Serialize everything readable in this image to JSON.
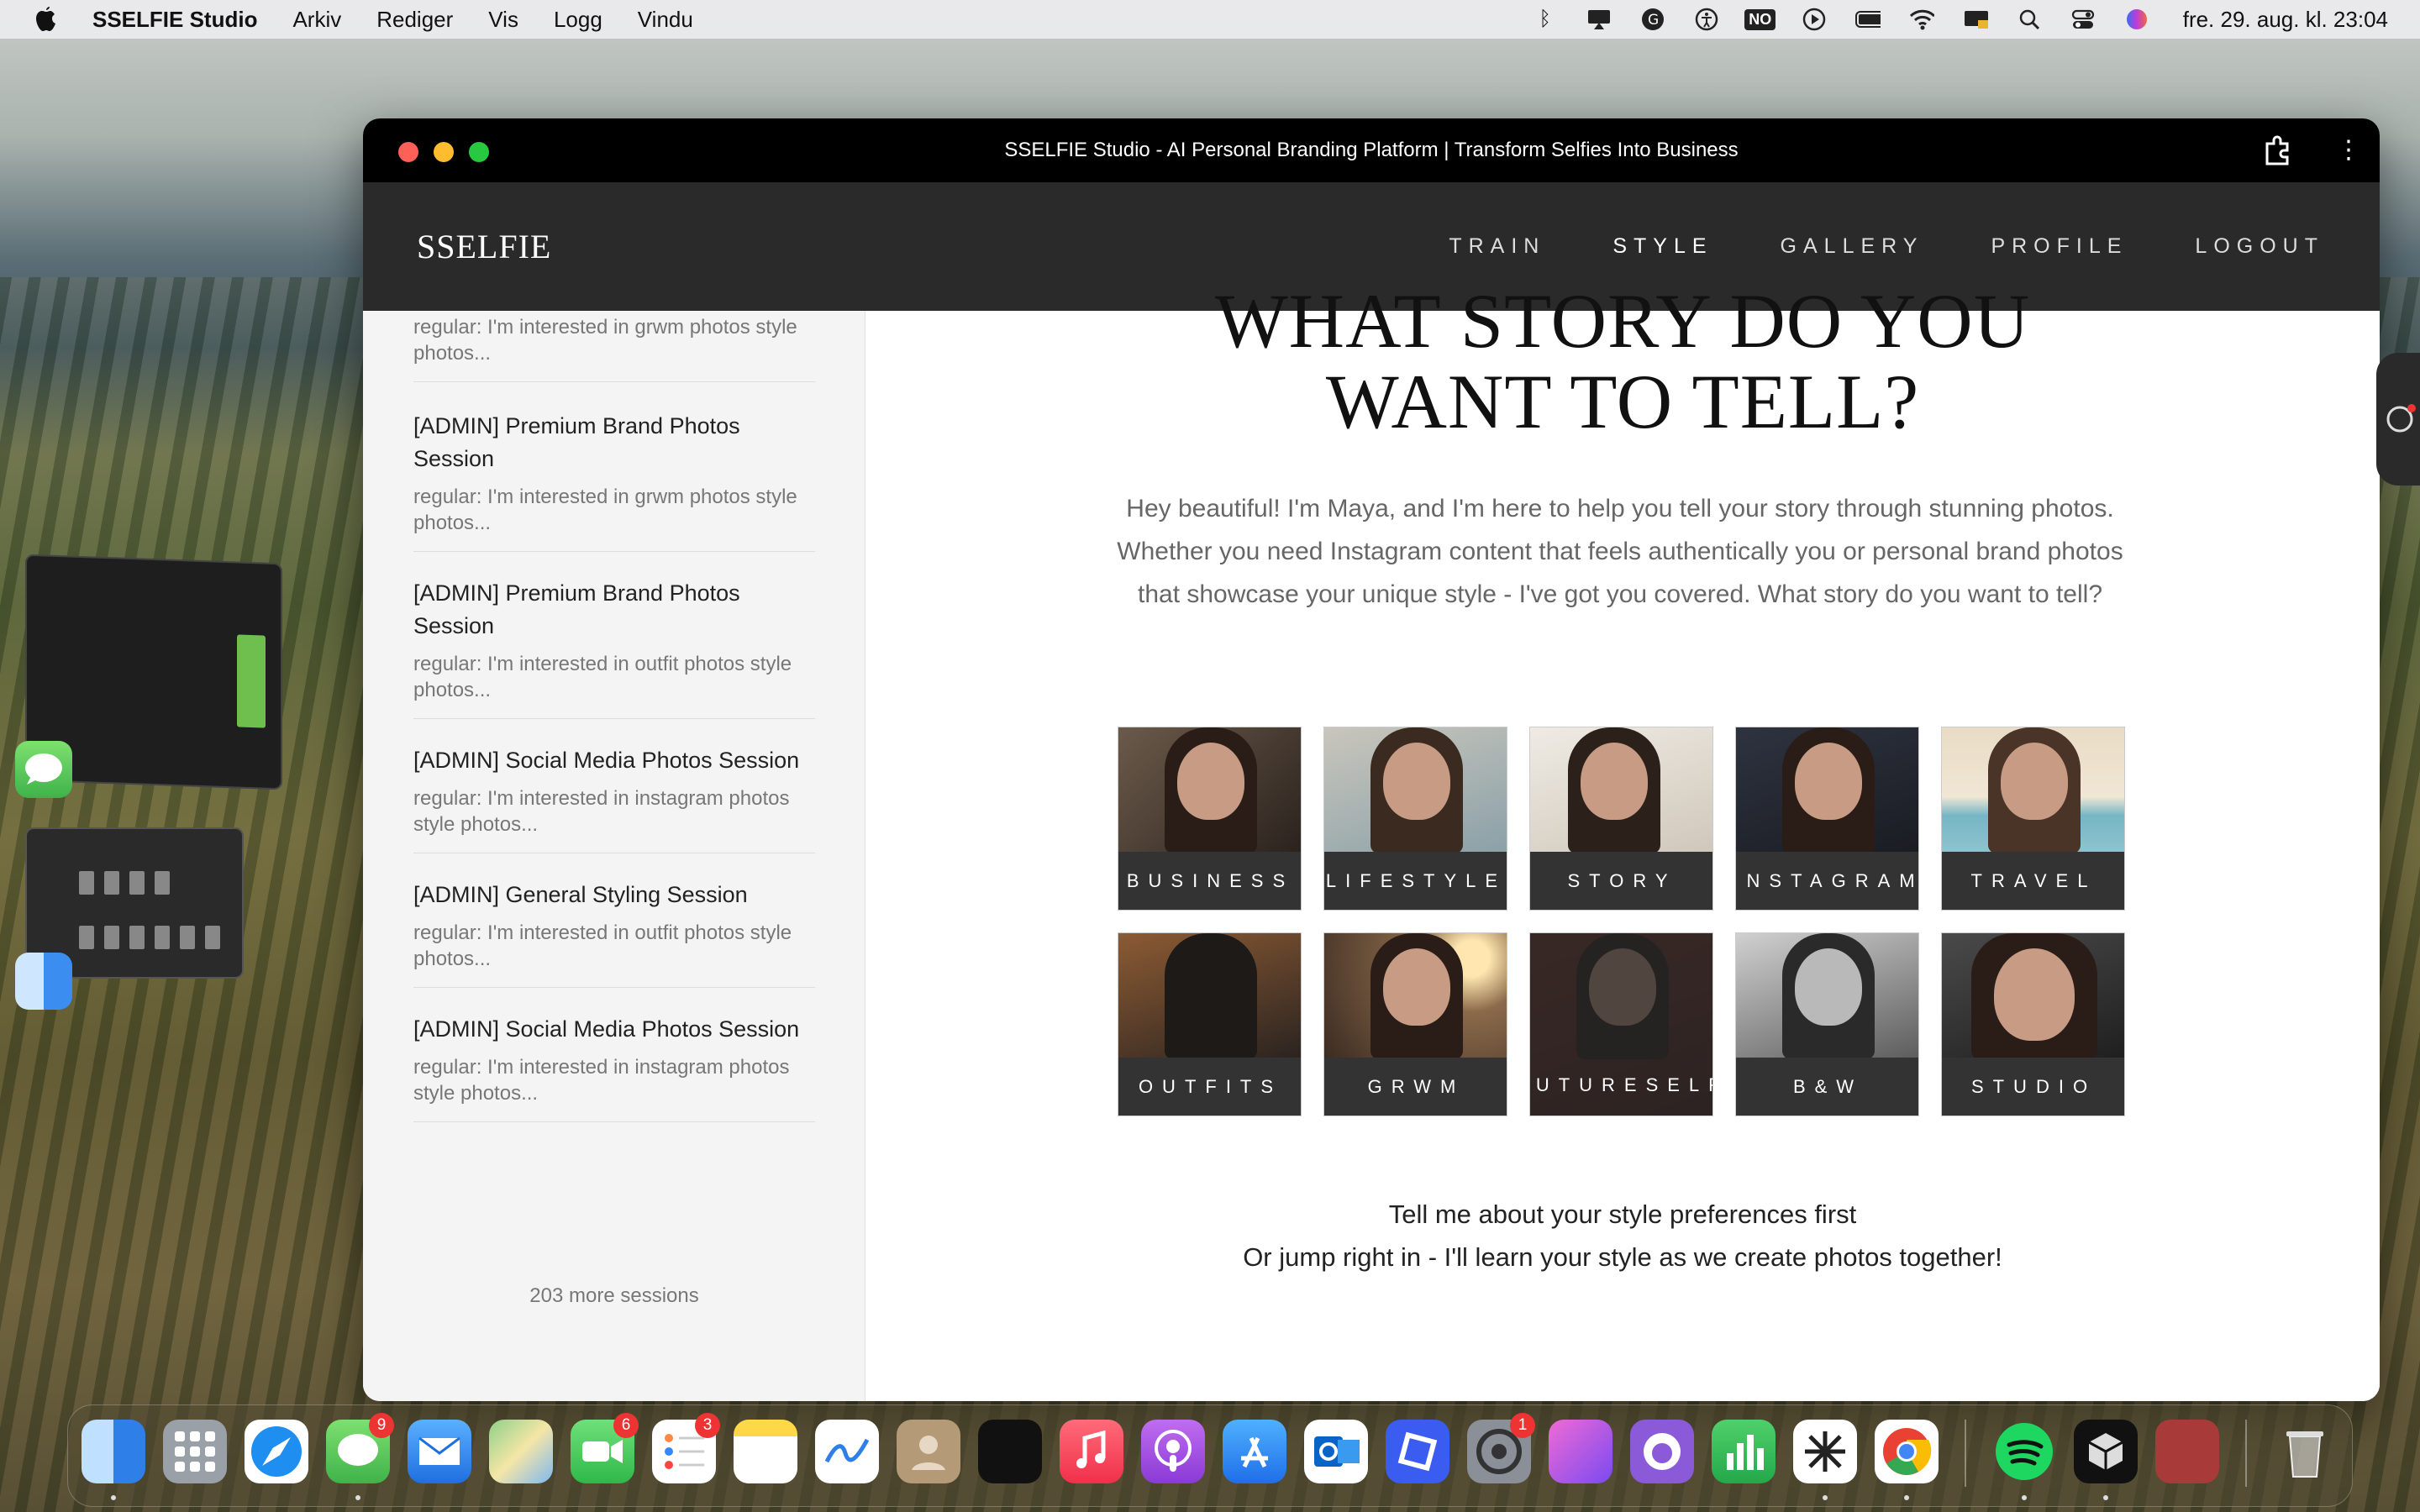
{
  "menubar": {
    "app_name": "SSELFIE Studio",
    "menus": [
      "Arkiv",
      "Rediger",
      "Vis",
      "Logg",
      "Vindu"
    ],
    "input_source": "NO",
    "clock": "fre. 29. aug. kl. 23:04"
  },
  "window": {
    "title": "SSELFIE Studio - AI Personal Branding Platform | Transform Selfies Into Business"
  },
  "nav": {
    "logo": "SSELFIE",
    "links": [
      "TRAIN",
      "STYLE",
      "GALLERY",
      "PROFILE",
      "LOGOUT"
    ],
    "active": "STYLE"
  },
  "sidebar": {
    "partial_top": "regular: I'm interested in grwm photos style photos...",
    "sessions": [
      {
        "title": "[ADMIN] Premium Brand Photos Session",
        "desc": "regular: I'm interested in grwm photos style photos..."
      },
      {
        "title": "[ADMIN] Premium Brand Photos Session",
        "desc": "regular: I'm interested in outfit photos style photos..."
      },
      {
        "title": "[ADMIN] Social Media Photos Session",
        "desc": "regular: I'm interested in instagram photos style photos..."
      },
      {
        "title": "[ADMIN] General Styling Session",
        "desc": "regular: I'm interested in outfit photos style photos..."
      },
      {
        "title": "[ADMIN] Social Media Photos Session",
        "desc": "regular: I'm interested in instagram photos style photos..."
      }
    ],
    "more_label": "203 more sessions"
  },
  "main": {
    "heading_line1": "WHAT STORY DO YOU",
    "heading_line2": "WANT TO TELL?",
    "intro": "Hey beautiful! I'm Maya, and I'm here to help you tell your story through stunning photos. Whether you need Instagram content that feels authentically you or personal brand photos that showcase your unique style - I've got you covered. What story do you want to tell?",
    "tiles": [
      "BUSINESS",
      "LIFESTYLE",
      "STORY",
      "INSTAGRAM",
      "TRAVEL",
      "OUTFITS",
      "GRWM",
      "FUTURESELF",
      "B&W",
      "STUDIO"
    ],
    "footer_line1": "Tell me about your style preferences first",
    "footer_line2": "Or jump right in - I'll learn your style as we create photos together!"
  },
  "dock": {
    "badges": {
      "messages": "9",
      "facetime": "6",
      "reminders": "3",
      "settings": "1"
    }
  }
}
